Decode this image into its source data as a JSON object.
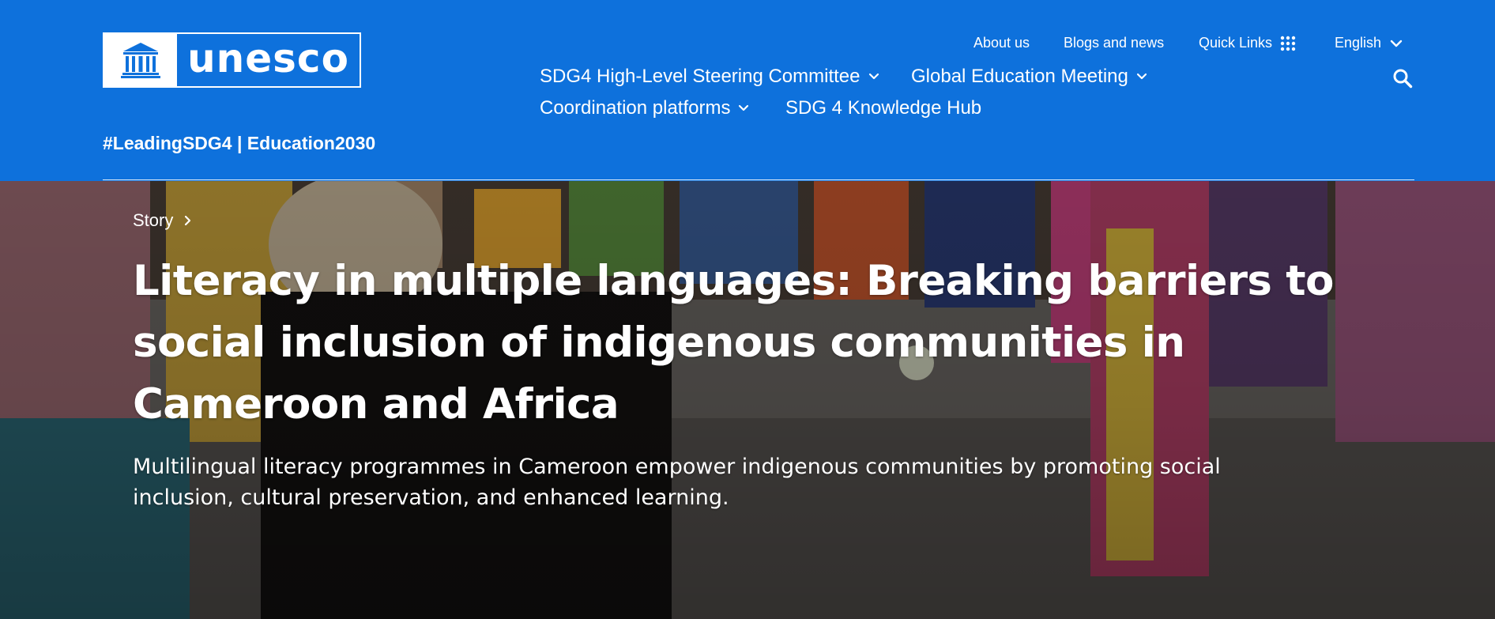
{
  "colors": {
    "header_bg": "#0e71dc",
    "text_on_brand": "#ffffff"
  },
  "logo": {
    "wordmark": "unesco",
    "emblem_icon": "unesco-temple-emblem"
  },
  "tagline": "#LeadingSDG4 | Education2030",
  "utility_nav": {
    "about": "About us",
    "blogs": "Blogs and news",
    "quick_links": "Quick Links",
    "quick_links_icon": "grid-dots-icon",
    "language": "English",
    "language_icon": "chevron-down-icon"
  },
  "main_nav": {
    "items": [
      {
        "label": "SDG4 High-Level Steering Committee",
        "has_dropdown": true
      },
      {
        "label": "Global Education Meeting",
        "has_dropdown": true
      },
      {
        "label": "Coordination platforms",
        "has_dropdown": true
      },
      {
        "label": "SDG 4 Knowledge Hub",
        "has_dropdown": false
      }
    ],
    "search_icon": "search-icon"
  },
  "hero": {
    "breadcrumb": "Story",
    "breadcrumb_icon": "chevron-right-icon",
    "title": "Literacy in multiple languages: Breaking barriers to social inclusion of indigenous communities in Cameroon and Africa",
    "subtitle": "Multilingual literacy programmes in Cameroon empower indigenous communities by promoting social inclusion, cultural preservation, and enhanced learning."
  }
}
